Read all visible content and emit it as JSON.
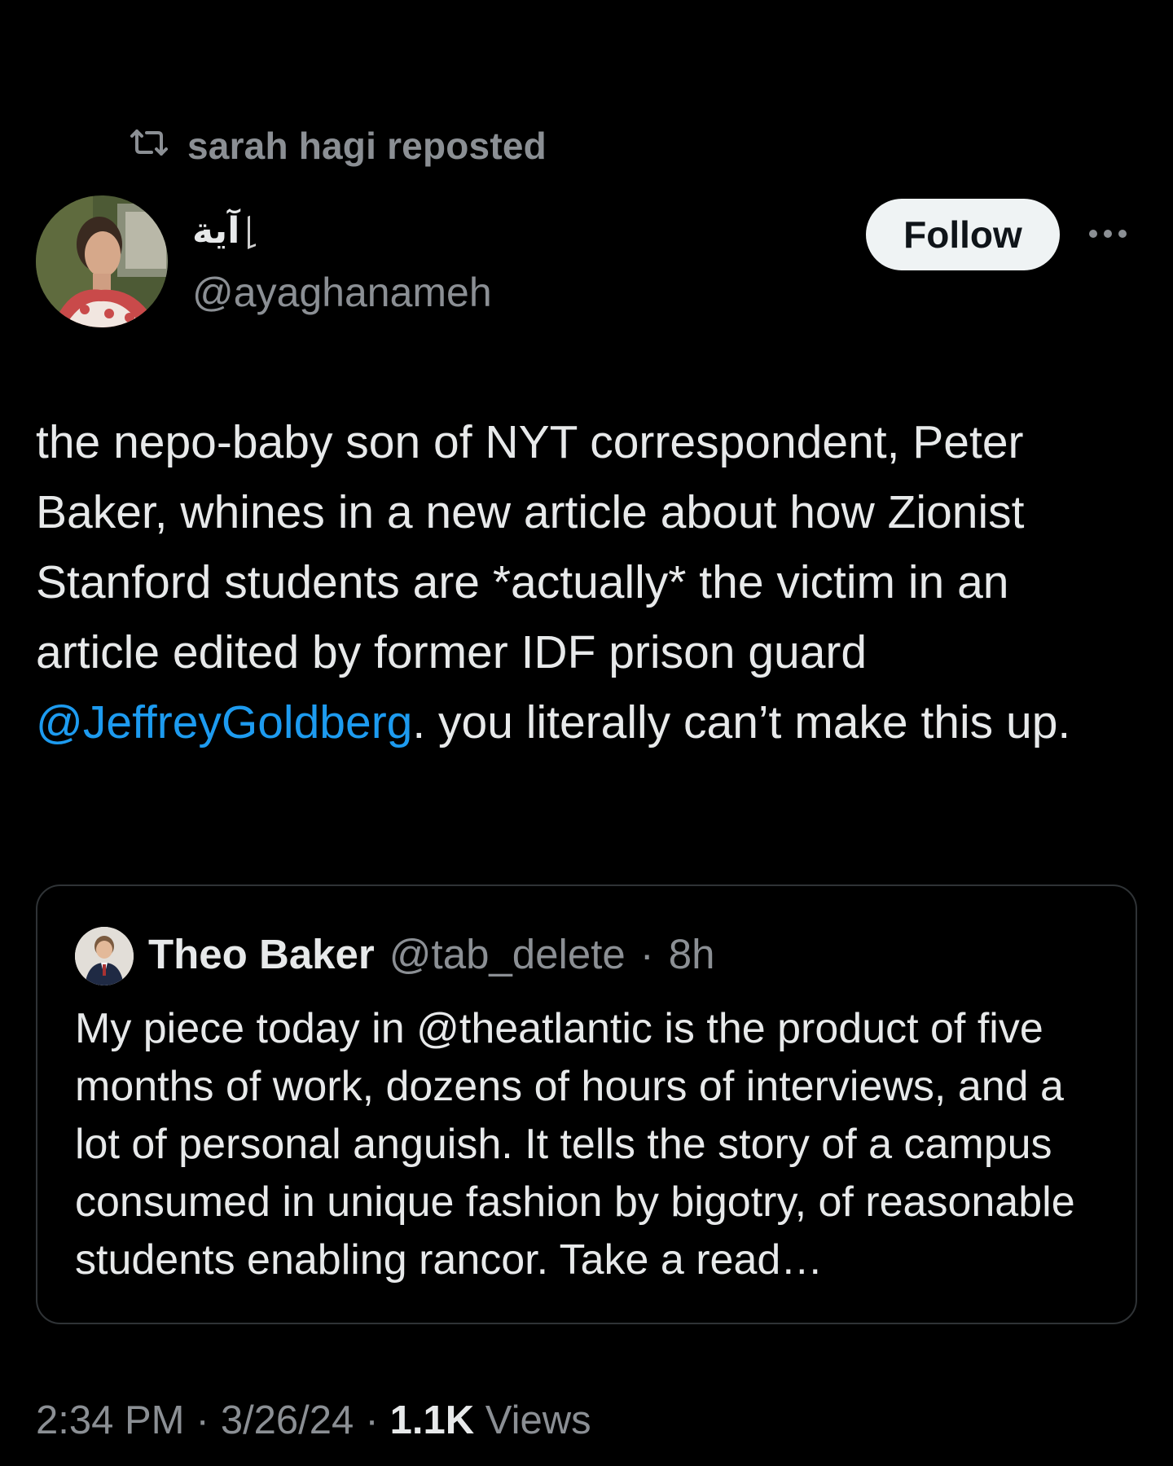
{
  "repost": {
    "label": "sarah hagi reposted",
    "icon": "repost-icon"
  },
  "author": {
    "display_name": "آية",
    "handle": "@ayaghanameh",
    "follow_label": "Follow",
    "more_icon": "more-icon"
  },
  "tweet": {
    "text_before": "the nepo-baby son of NYT correspondent, Peter Baker, whines in a new article about how Zionist Stanford students are *actually* the victim in an article edited by former IDF prison guard ",
    "mention": "@JeffreyGoldberg",
    "text_after": ". you literally can’t make this up."
  },
  "quoted": {
    "name": "Theo Baker",
    "handle": "@tab_delete",
    "separator": "·",
    "time": "8h",
    "text": "My piece today in @theatlantic is the product of five months of work, dozens of hours of interviews, and a lot of personal anguish. It tells the story of a campus consumed in unique fashion by bigotry, of reasonable students enabling rancor. Take a read…"
  },
  "meta": {
    "time": "2:34 PM",
    "sep1": "·",
    "date": "3/26/24",
    "sep2": "·",
    "views_count": "1.1K",
    "views_label": "Views"
  },
  "colors": {
    "background": "#000000",
    "text": "#e7e9ea",
    "secondary": "#8b8f94",
    "link": "#1d9bf0",
    "border": "#2f3336"
  }
}
